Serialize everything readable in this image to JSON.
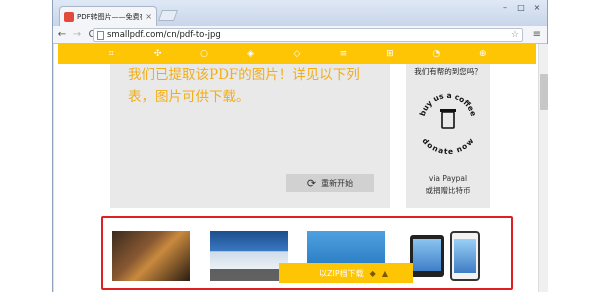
{
  "browser": {
    "tab_title": "PDF转图片——免费在线",
    "tab_close": "×",
    "url": "smallpdf.com/cn/pdf-to-jpg",
    "back": "←",
    "forward": "→",
    "reload": "C",
    "star": "☆",
    "menu": "≡",
    "minimize": "–",
    "maximize": "□",
    "close": "×"
  },
  "toolbar_icons": [
    {
      "name": "compress-icon",
      "glyph": "⌗"
    },
    {
      "name": "convert-icon",
      "glyph": "✣"
    },
    {
      "name": "circle-icon",
      "glyph": "○"
    },
    {
      "name": "merge-icon",
      "glyph": "◈"
    },
    {
      "name": "split-icon",
      "glyph": "◇"
    },
    {
      "name": "protect-icon",
      "glyph": "≡"
    },
    {
      "name": "grid-icon",
      "glyph": "⊞"
    },
    {
      "name": "pie-icon",
      "glyph": "◔"
    },
    {
      "name": "lock-icon",
      "glyph": "⊕"
    }
  ],
  "result": {
    "message": "我们已提取该PDF的图片！详见以下列表，图片可供下载。",
    "restart_label": "重新开始",
    "restart_icon": "⟳"
  },
  "donate": {
    "heading": "我们有帮的到您吗？",
    "badge_top": "buy us a coffee",
    "badge_bottom": "donate now",
    "via": "via Paypal",
    "sub": "或捐赠比特币"
  },
  "download": {
    "label": "以ZIP档下载",
    "dropbox_icon": "◆",
    "drive_icon": "▲"
  },
  "colors": {
    "accent": "#fec505",
    "highlight": "#e02020",
    "result_text": "#f3ad14"
  }
}
